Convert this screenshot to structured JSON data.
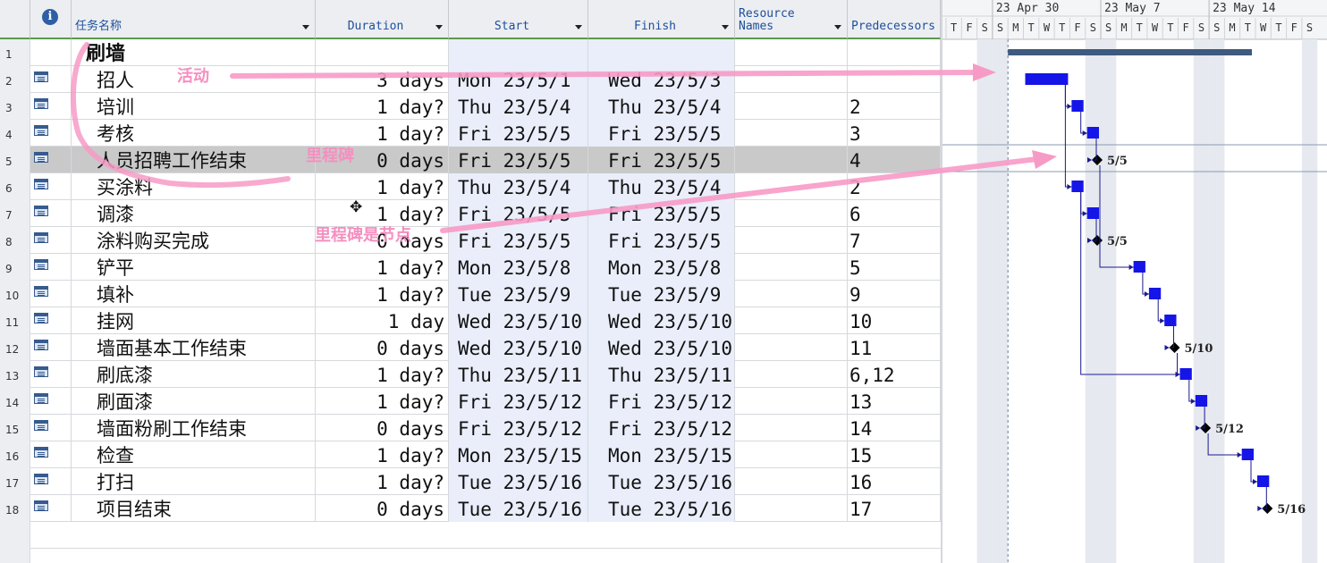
{
  "columns": {
    "info": "i",
    "name": "任务名称",
    "duration": "Duration",
    "start": "Start",
    "finish": "Finish",
    "resource": "Resource Names",
    "resource_line1": "Resource",
    "resource_line2": "Names",
    "predecessors": "Predecessors"
  },
  "tasks": [
    {
      "id": "1",
      "name": "刷墙",
      "duration": "",
      "start": "",
      "finish": "",
      "pred": "",
      "summary": true
    },
    {
      "id": "2",
      "name": "招人",
      "duration": "3 days",
      "start": "Mon 23/5/1",
      "finish": "Wed 23/5/3",
      "pred": ""
    },
    {
      "id": "3",
      "name": "培训",
      "duration": "1 day?",
      "start": "Thu 23/5/4",
      "finish": "Thu 23/5/4",
      "pred": "2"
    },
    {
      "id": "4",
      "name": "考核",
      "duration": "1 day?",
      "start": "Fri 23/5/5",
      "finish": "Fri 23/5/5",
      "pred": "3"
    },
    {
      "id": "5",
      "name": "人员招聘工作结束",
      "duration": "0 days",
      "start": "Fri 23/5/5",
      "finish": "Fri 23/5/5",
      "pred": "4",
      "selected": true
    },
    {
      "id": "6",
      "name": "买涂料",
      "duration": "1 day?",
      "start": "Thu 23/5/4",
      "finish": "Thu 23/5/4",
      "pred": "2"
    },
    {
      "id": "7",
      "name": "调漆",
      "duration": "1 day?",
      "start": "Fri 23/5/5",
      "finish": "Fri 23/5/5",
      "pred": "6"
    },
    {
      "id": "8",
      "name": "涂料购买完成",
      "duration": "0 days",
      "start": "Fri 23/5/5",
      "finish": "Fri 23/5/5",
      "pred": "7"
    },
    {
      "id": "9",
      "name": "铲平",
      "duration": "1 day?",
      "start": "Mon 23/5/8",
      "finish": "Mon 23/5/8",
      "pred": "5"
    },
    {
      "id": "10",
      "name": "填补",
      "duration": "1 day?",
      "start": "Tue 23/5/9",
      "finish": "Tue 23/5/9",
      "pred": "9"
    },
    {
      "id": "11",
      "name": "挂网",
      "duration": "1 day",
      "start": "Wed 23/5/10",
      "finish": "Wed 23/5/10",
      "pred": "10"
    },
    {
      "id": "12",
      "name": "墙面基本工作结束",
      "duration": "0 days",
      "start": "Wed 23/5/10",
      "finish": "Wed 23/5/10",
      "pred": "11"
    },
    {
      "id": "13",
      "name": "刷底漆",
      "duration": "1 day?",
      "start": "Thu 23/5/11",
      "finish": "Thu 23/5/11",
      "pred": "6,12"
    },
    {
      "id": "14",
      "name": "刷面漆",
      "duration": "1 day?",
      "start": "Fri 23/5/12",
      "finish": "Fri 23/5/12",
      "pred": "13"
    },
    {
      "id": "15",
      "name": "墙面粉刷工作结束",
      "duration": "0 days",
      "start": "Fri 23/5/12",
      "finish": "Fri 23/5/12",
      "pred": "14"
    },
    {
      "id": "16",
      "name": "检查",
      "duration": "1 day?",
      "start": "Mon 23/5/15",
      "finish": "Mon 23/5/15",
      "pred": "15"
    },
    {
      "id": "17",
      "name": "打扫",
      "duration": "1 day?",
      "start": "Tue 23/5/16",
      "finish": "Tue 23/5/16",
      "pred": "16"
    },
    {
      "id": "18",
      "name": "项目结束",
      "duration": "0 days",
      "start": "Tue 23/5/16",
      "finish": "Tue 23/5/16",
      "pred": "17"
    }
  ],
  "gantt": {
    "weeks": [
      "23 Apr 30",
      "23 May 7",
      "23 May 14"
    ],
    "day_letters": [
      "T",
      "F",
      "S",
      "S",
      "M",
      "T",
      "W",
      "T",
      "F",
      "S",
      "S",
      "M",
      "T",
      "W",
      "T",
      "F",
      "S",
      "S",
      "M",
      "T",
      "W",
      "T",
      "F",
      "S"
    ],
    "milestone_labels": [
      "5/5",
      "5/5",
      "5/10",
      "5/12",
      "5/16"
    ],
    "colors": {
      "task": "#1515e8",
      "summary": "#3e5a7e",
      "weekend": "#e6e9ef",
      "link": "#1a1a8c"
    }
  },
  "annotations": [
    "活动",
    "里程碑",
    "里程碑是节点"
  ]
}
